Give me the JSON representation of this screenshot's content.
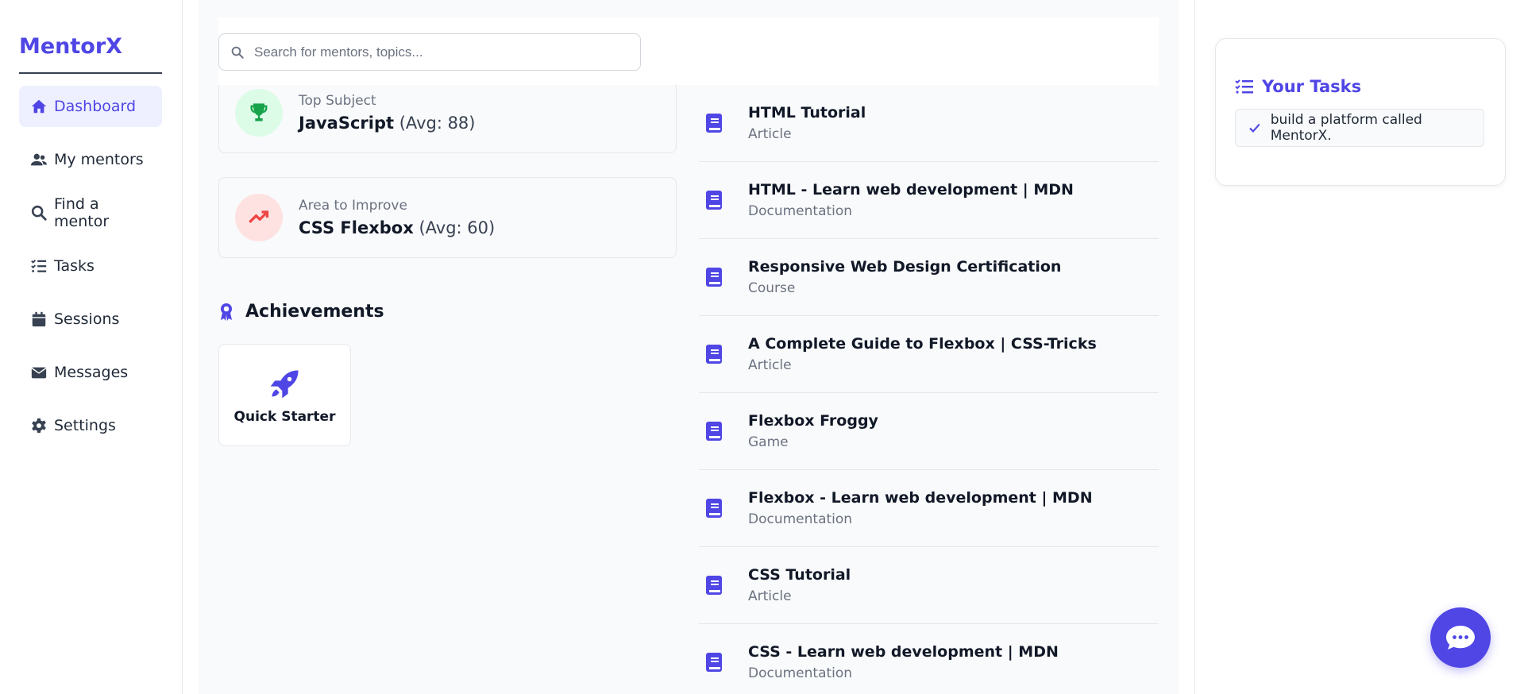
{
  "app": {
    "name": "MentorX"
  },
  "sidebar": {
    "items": [
      {
        "label": "Dashboard",
        "icon": "home-icon",
        "active": true
      },
      {
        "label": "My mentors",
        "icon": "users-icon"
      },
      {
        "label": "Find a mentor",
        "icon": "search-icon"
      },
      {
        "label": "Tasks",
        "icon": "list-check-icon"
      },
      {
        "label": "Sessions",
        "icon": "calendar-icon"
      },
      {
        "label": "Messages",
        "icon": "envelope-icon"
      },
      {
        "label": "Settings",
        "icon": "gear-icon"
      }
    ]
  },
  "search": {
    "placeholder": "Search for mentors, topics..."
  },
  "stats": {
    "top_subject": {
      "label": "Top Subject",
      "subject": "JavaScript",
      "avg": "(Avg: 88)",
      "icon": "trophy-icon",
      "color": "#16a34a"
    },
    "improve": {
      "label": "Area to Improve",
      "subject": "CSS Flexbox",
      "avg": "(Avg: 60)",
      "icon": "trending-up-icon",
      "color": "#ef4444"
    }
  },
  "achievements": {
    "title": "Achievements",
    "badges": [
      {
        "label": "Quick Starter",
        "icon": "rocket-icon"
      }
    ]
  },
  "resources": [
    {
      "title": "HTML Tutorial",
      "type": "Article"
    },
    {
      "title": "HTML - Learn web development | MDN",
      "type": "Documentation"
    },
    {
      "title": "Responsive Web Design Certification",
      "type": "Course"
    },
    {
      "title": "A Complete Guide to Flexbox | CSS-Tricks",
      "type": "Article"
    },
    {
      "title": "Flexbox Froggy",
      "type": "Game"
    },
    {
      "title": "Flexbox - Learn web development | MDN",
      "type": "Documentation"
    },
    {
      "title": "CSS Tutorial",
      "type": "Article"
    },
    {
      "title": "CSS - Learn web development | MDN",
      "type": "Documentation"
    }
  ],
  "tasks_panel": {
    "title": "Your Tasks",
    "items": [
      {
        "label": "build a platform called MentorX.",
        "done": true
      }
    ]
  },
  "colors": {
    "accent": "#4f46e5",
    "accent_light": "#eef0ff"
  }
}
